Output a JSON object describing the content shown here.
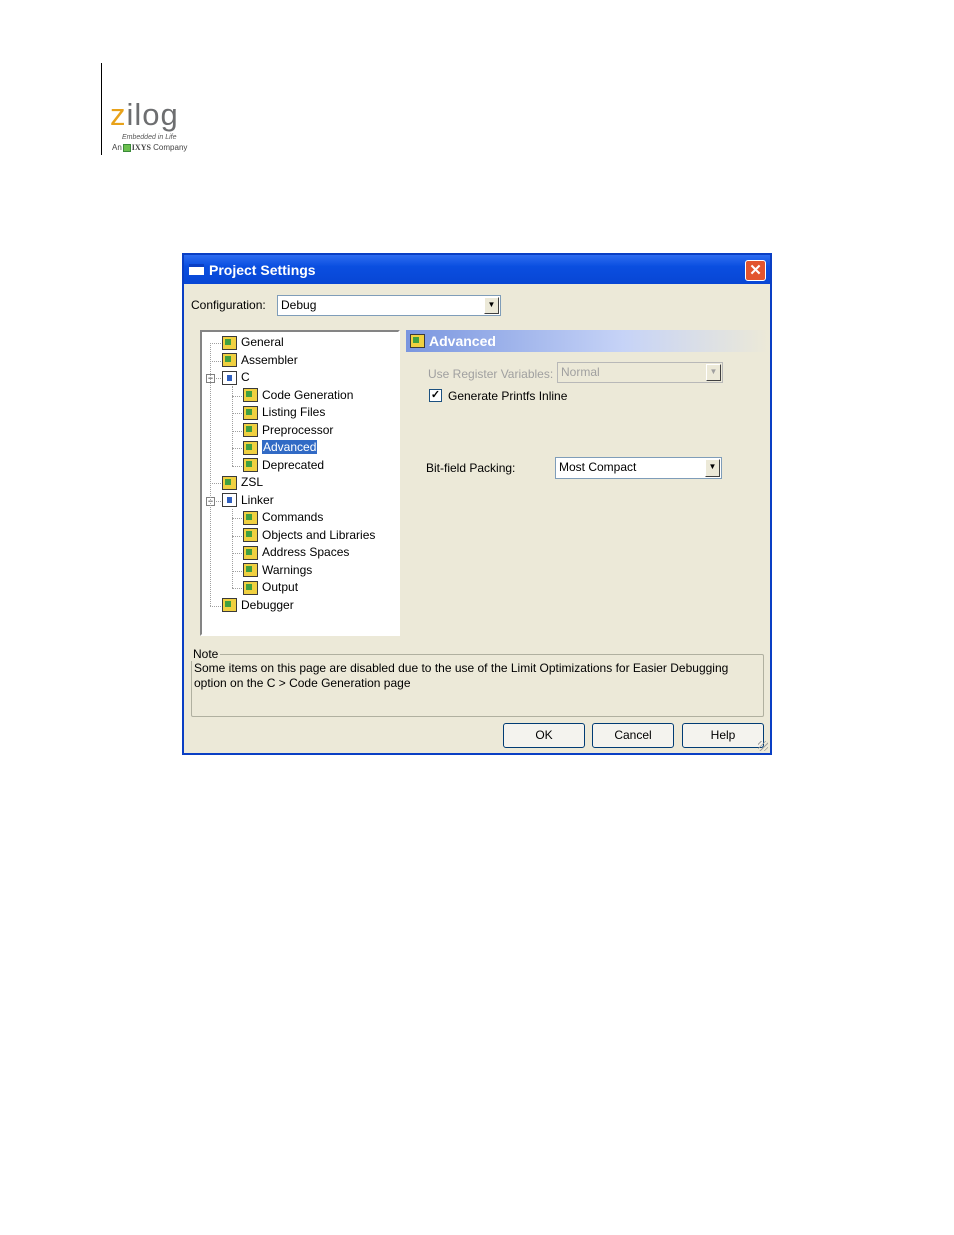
{
  "logo": {
    "brand": "zilog",
    "tagline": "Embedded in Life",
    "company_prefix": "An",
    "company_name": "IXYS",
    "company_suffix": "Company"
  },
  "dialog": {
    "title": "Project Settings",
    "close_glyph": "✕",
    "configuration_label": "Configuration:",
    "configuration_value": "Debug",
    "tree": [
      {
        "label": "General",
        "level": 0,
        "icon": "settings-gear-icon"
      },
      {
        "label": "Assembler",
        "level": 0,
        "icon": "settings-gear-icon"
      },
      {
        "label": "C",
        "level": 0,
        "icon": "folder-icon",
        "expanded": true
      },
      {
        "label": "Code Generation",
        "level": 1,
        "icon": "settings-gear-icon"
      },
      {
        "label": "Listing Files",
        "level": 1,
        "icon": "settings-gear-icon"
      },
      {
        "label": "Preprocessor",
        "level": 1,
        "icon": "settings-gear-icon"
      },
      {
        "label": "Advanced",
        "level": 1,
        "icon": "settings-gear-icon",
        "selected": true
      },
      {
        "label": "Deprecated",
        "level": 1,
        "icon": "settings-gear-icon"
      },
      {
        "label": "ZSL",
        "level": 0,
        "icon": "settings-gear-icon"
      },
      {
        "label": "Linker",
        "level": 0,
        "icon": "folder-icon",
        "expanded": true
      },
      {
        "label": "Commands",
        "level": 1,
        "icon": "settings-gear-icon"
      },
      {
        "label": "Objects and Libraries",
        "level": 1,
        "icon": "settings-gear-icon"
      },
      {
        "label": "Address Spaces",
        "level": 1,
        "icon": "settings-gear-icon"
      },
      {
        "label": "Warnings",
        "level": 1,
        "icon": "settings-gear-icon"
      },
      {
        "label": "Output",
        "level": 1,
        "icon": "settings-gear-icon"
      },
      {
        "label": "Debugger",
        "level": 0,
        "icon": "settings-gear-icon"
      }
    ],
    "panel": {
      "title": "Advanced",
      "use_register_variables_label": "Use Register Variables:",
      "use_register_variables_value": "Normal",
      "use_register_variables_enabled": false,
      "generate_printfs_inline_label": "Generate Printfs Inline",
      "generate_printfs_inline_checked": true,
      "bitfield_packing_label": "Bit-field Packing:",
      "bitfield_packing_value": "Most Compact"
    },
    "note": {
      "title": "Note",
      "text": "Some items on this page are disabled due to the use of the Limit Optimizations for Easier Debugging option on the C > Code Generation page"
    },
    "buttons": {
      "ok": "OK",
      "cancel": "Cancel",
      "help": "Help"
    }
  }
}
